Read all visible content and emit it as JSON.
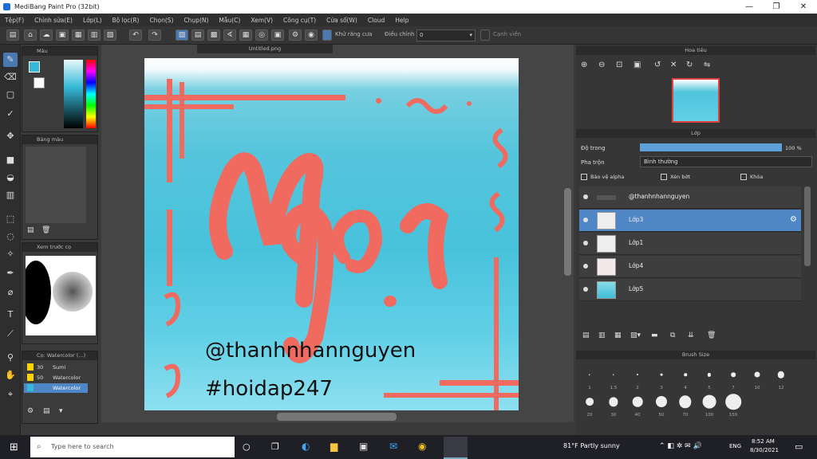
{
  "window": {
    "title": "MediBang Paint Pro (32bit)"
  },
  "menu": [
    "Tệp(F)",
    "Chỉnh sửa(E)",
    "Lớp(L)",
    "Bộ lọc(R)",
    "Chọn(S)",
    "Chụp(N)",
    "Mẫu(C)",
    "Xem(V)",
    "Công cụ(T)",
    "Cửa sổ(W)",
    "Cloud",
    "Help"
  ],
  "toolbar": {
    "correction_label": "Khử răng cưa",
    "adjust_label": "Điều chỉnh",
    "adjust_value": "0",
    "snap_label": "Cạnh viền"
  },
  "doc_tab": "Untitled.png",
  "color_panel": {
    "title": "Màu",
    "fg": "#36b9d9",
    "bg": "#ffffff"
  },
  "palette_panel": {
    "title": "Bảng màu"
  },
  "navigator_left": {
    "title": "Xem trước cọ"
  },
  "brush_list": {
    "title": "Cọ: Watercolor (...)",
    "items": [
      {
        "size": "30",
        "name": "Sumi"
      },
      {
        "size": "50",
        "name": "Watercolor"
      },
      {
        "size": "",
        "name": "Watercolor"
      }
    ]
  },
  "canvas": {
    "line1": "@thanhnhannguyen",
    "line2": "#hoidap247",
    "lettering": "Ngọi"
  },
  "navigator": {
    "title": "Hoa tiêu"
  },
  "layers": {
    "title": "Lớp",
    "opacity_label": "Độ trong",
    "opacity_value": "100 %",
    "blend_label": "Pha trộn",
    "blend_value": "Bình thường",
    "protect_label": "Bảo vệ alpha",
    "clip_label": "Xén bớt",
    "lock_label": "Khóa",
    "items": [
      {
        "name": "@thanhnhannguyen",
        "type": "text"
      },
      {
        "name": "Lớp3",
        "type": "raster"
      },
      {
        "name": "Lớp1",
        "type": "raster"
      },
      {
        "name": "Lớp4",
        "type": "raster"
      },
      {
        "name": "Lớp5",
        "type": "raster"
      }
    ]
  },
  "brush_size": {
    "title": "Brush Size",
    "row1": [
      "1",
      "1.5",
      "2",
      "3",
      "4",
      "5",
      "7",
      "10",
      "12"
    ],
    "row2": [
      "20",
      "30",
      "40",
      "50",
      "70",
      "100",
      "150"
    ]
  },
  "taskbar": {
    "search_placeholder": "Type here to search",
    "weather": "81°F  Partly sunny",
    "lang": "ENG",
    "time": "8:52 AM",
    "date": "8/30/2021"
  }
}
